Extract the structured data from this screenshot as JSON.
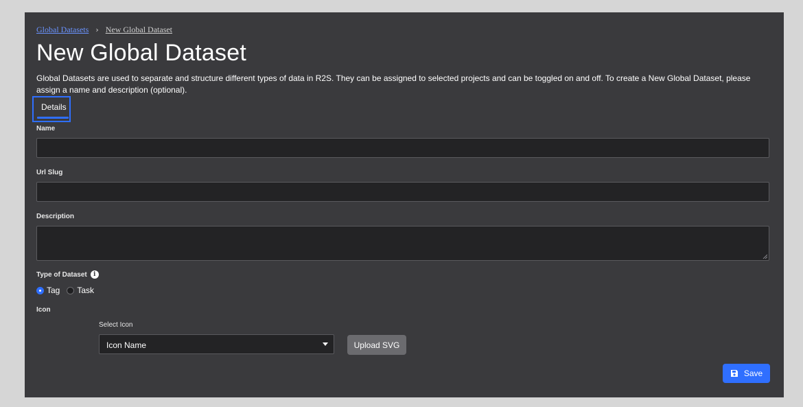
{
  "breadcrumb": {
    "parent": "Global Datasets",
    "separator": "›",
    "current": "New Global Dataset"
  },
  "page": {
    "title": "New Global Dataset",
    "description": "Global Datasets are used to separate and structure different types of data in R2S. They can be assigned to selected projects and can be toggled on and off. To create a New Global Dataset, please assign a name and description (optional)."
  },
  "tabs": [
    {
      "label": "Details",
      "active": true
    }
  ],
  "form": {
    "name": {
      "label": "Name",
      "value": ""
    },
    "url_slug": {
      "label": "Url Slug",
      "value": ""
    },
    "description": {
      "label": "Description",
      "value": ""
    },
    "dataset_type": {
      "label": "Type of Dataset",
      "info_icon": "info-icon",
      "options": [
        {
          "label": "Tag",
          "selected": true
        },
        {
          "label": "Task",
          "selected": false
        }
      ]
    },
    "icon": {
      "label": "Icon",
      "select_label": "Select Icon",
      "select_value": "Icon Name",
      "upload_label": "Upload SVG"
    }
  },
  "actions": {
    "save_label": "Save",
    "save_icon": "floppy-disk-icon"
  },
  "colors": {
    "accent": "#2f6fff",
    "panel_bg": "#3a3a3d",
    "input_bg": "#232325",
    "page_bg": "#d6d6d6",
    "link": "#6a93ff"
  }
}
